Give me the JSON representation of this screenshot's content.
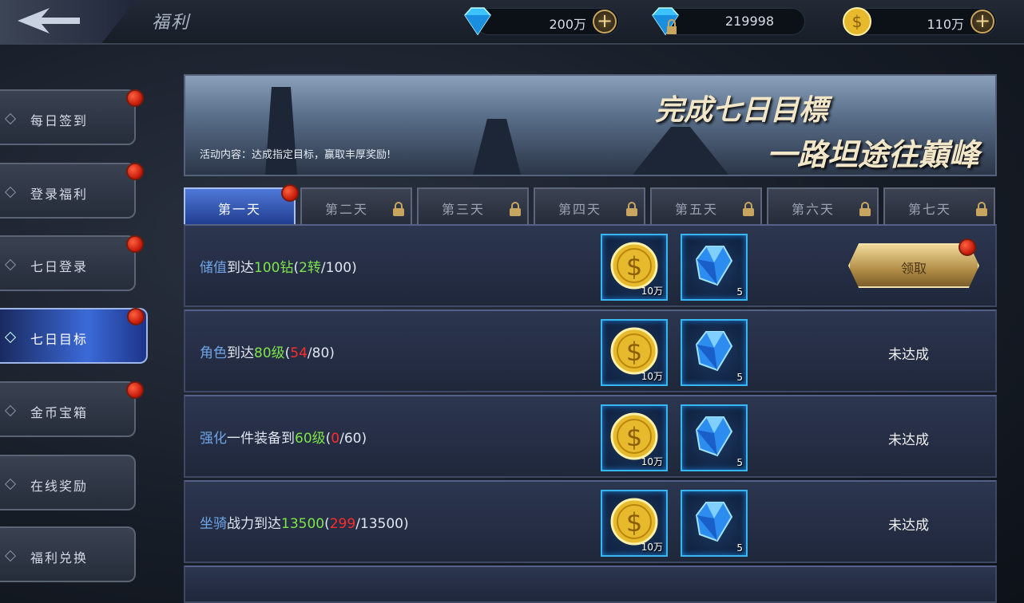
{
  "header": {
    "title": "福利",
    "currencies": [
      {
        "icon": "diamond-icon",
        "value": "200万",
        "has_plus": true
      },
      {
        "icon": "locked-diamond-icon",
        "value": "219998",
        "has_plus": false
      },
      {
        "icon": "gold-coin-icon",
        "value": "110万",
        "has_plus": true
      }
    ]
  },
  "sidebar": {
    "items": [
      {
        "label": "每日签到",
        "badge": true,
        "active": false
      },
      {
        "label": "登录福利",
        "badge": true,
        "active": false
      },
      {
        "label": "七日登录",
        "badge": true,
        "active": false
      },
      {
        "label": "七日目标",
        "badge": true,
        "active": true
      },
      {
        "label": "金币宝箱",
        "badge": true,
        "active": false
      },
      {
        "label": "在线奖励",
        "badge": false,
        "active": false
      },
      {
        "label": "福利兑换",
        "badge": false,
        "active": false
      }
    ]
  },
  "banner": {
    "line1": "完成七日目標",
    "line2": "一路坦途往巔峰",
    "description": "活动内容：达成指定目标，赢取丰厚奖励!"
  },
  "tabs": [
    {
      "label": "第一天",
      "locked": false,
      "active": true,
      "badge": true
    },
    {
      "label": "第二天",
      "locked": true,
      "active": false
    },
    {
      "label": "第三天",
      "locked": true,
      "active": false
    },
    {
      "label": "第四天",
      "locked": true,
      "active": false
    },
    {
      "label": "第五天",
      "locked": true,
      "active": false
    },
    {
      "label": "第六天",
      "locked": true,
      "active": false
    },
    {
      "label": "第七天",
      "locked": true,
      "active": false
    }
  ],
  "tasks": [
    {
      "parts": [
        {
          "t": "储值",
          "c": "blue"
        },
        {
          "t": "到达",
          "c": "white"
        },
        {
          "t": "100钻",
          "c": "green"
        },
        {
          "t": "(",
          "c": "white"
        },
        {
          "t": "2转",
          "c": "green"
        },
        {
          "t": "/100)",
          "c": "white"
        }
      ],
      "rewards": [
        {
          "icon": "gold-coin-icon",
          "count": "10万"
        },
        {
          "icon": "blue-gem-icon",
          "count": "5"
        }
      ],
      "action": "领取",
      "claimable": true
    },
    {
      "parts": [
        {
          "t": "角色",
          "c": "blue"
        },
        {
          "t": "到达",
          "c": "white"
        },
        {
          "t": "80级",
          "c": "green"
        },
        {
          "t": "(",
          "c": "white"
        },
        {
          "t": "54",
          "c": "red"
        },
        {
          "t": "/80)",
          "c": "white"
        }
      ],
      "rewards": [
        {
          "icon": "gold-coin-icon",
          "count": "10万"
        },
        {
          "icon": "blue-gem-icon",
          "count": "5"
        }
      ],
      "action": "未达成",
      "claimable": false
    },
    {
      "parts": [
        {
          "t": "强化",
          "c": "blue"
        },
        {
          "t": "一件装备到",
          "c": "white"
        },
        {
          "t": "60级",
          "c": "green"
        },
        {
          "t": "(",
          "c": "white"
        },
        {
          "t": "0",
          "c": "red"
        },
        {
          "t": "/60)",
          "c": "white"
        }
      ],
      "rewards": [
        {
          "icon": "gold-coin-icon",
          "count": "10万"
        },
        {
          "icon": "blue-gem-icon",
          "count": "5"
        }
      ],
      "action": "未达成",
      "claimable": false
    },
    {
      "parts": [
        {
          "t": "坐骑",
          "c": "blue"
        },
        {
          "t": "战力到达",
          "c": "white"
        },
        {
          "t": "13500",
          "c": "green"
        },
        {
          "t": "(",
          "c": "white"
        },
        {
          "t": "299",
          "c": "red"
        },
        {
          "t": "/13500)",
          "c": "white"
        }
      ],
      "rewards": [
        {
          "icon": "gold-coin-icon",
          "count": "10万"
        },
        {
          "icon": "blue-gem-icon",
          "count": "5"
        }
      ],
      "action": "未达成",
      "claimable": false
    }
  ],
  "colors": {
    "accent_blue": "#6fa4e6",
    "accent_green": "#7ee44a",
    "accent_red": "#ff2c2c",
    "gold": "#c8a660"
  }
}
